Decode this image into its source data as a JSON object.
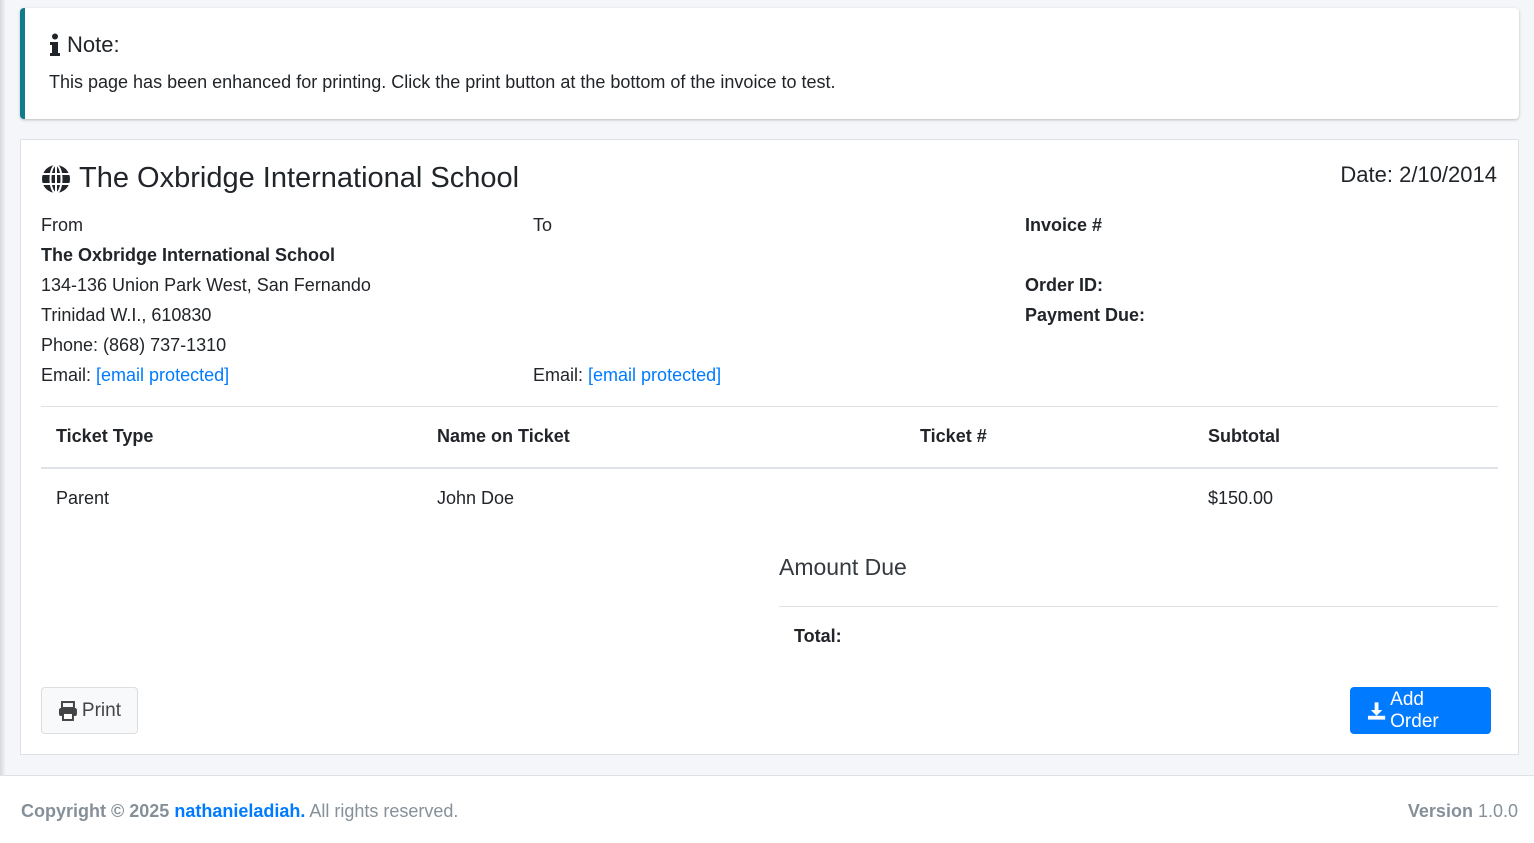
{
  "note": {
    "title": "Note:",
    "text": "This page has been enhanced for printing. Click the print button at the bottom of the invoice to test."
  },
  "invoice": {
    "title": "The Oxbridge International School",
    "date": "Date: 2/10/2014",
    "from": {
      "label": "From",
      "name": "The Oxbridge International School",
      "address1": "134-136 Union Park West, San Fernando",
      "address2": "Trinidad W.I., 610830",
      "phone": "Phone: (868) 737-1310",
      "email_label": "Email:",
      "email": "[email protected]"
    },
    "to": {
      "label": "To",
      "email_label": "Email:",
      "email": "[email protected]"
    },
    "meta": {
      "invoice_label": "Invoice #",
      "order_label": "Order ID:",
      "payment_label": "Payment Due:"
    },
    "table": {
      "headers": [
        "Ticket Type",
        "Name on Ticket",
        "Ticket #",
        "Subtotal"
      ],
      "rows": [
        [
          "Parent",
          "John Doe",
          "",
          "$150.00"
        ]
      ]
    },
    "amount_due": "Amount Due",
    "total_label": "Total:",
    "print_label": "Print",
    "add_order_label": "Add Order"
  },
  "footer": {
    "copyright_prefix": "Copyright © 2025",
    "author": "nathanieladiah.",
    "rights": "All rights reserved.",
    "version_label": "Version",
    "version": "1.0.0"
  },
  "colors": {
    "accent": "#007bff",
    "callout_border": "#117a8b"
  }
}
